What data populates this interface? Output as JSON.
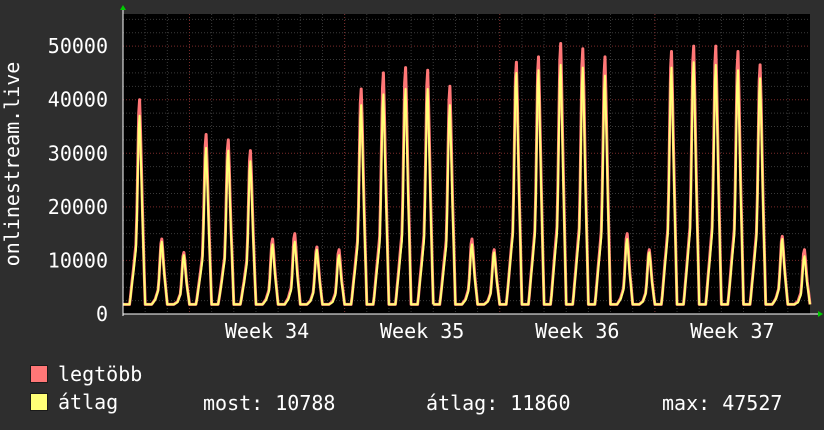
{
  "chart_data": {
    "type": "area",
    "ylabel": "onlinestream.live",
    "ylim": [
      0,
      56000
    ],
    "yticks": [
      0,
      10000,
      20000,
      30000,
      40000,
      50000
    ],
    "ytick_labels": [
      "0",
      "10000",
      "20000",
      "30000",
      "40000",
      "50000"
    ],
    "week_labels": [
      "Week 34",
      "Week 35",
      "Week 36",
      "Week 37"
    ],
    "series": [
      {
        "name": "legtöbb",
        "key": "max",
        "color": "#ff7777"
      },
      {
        "name": "átlag",
        "key": "avg",
        "color": "#ffff77"
      }
    ],
    "days": [
      {
        "max": 40000,
        "avg": 37000
      },
      {
        "max": 14000,
        "avg": 13500
      },
      {
        "max": 11500,
        "avg": 11000
      },
      {
        "max": 33500,
        "avg": 31000
      },
      {
        "max": 32500,
        "avg": 30500
      },
      {
        "max": 30500,
        "avg": 28500
      },
      {
        "max": 14000,
        "avg": 13000
      },
      {
        "max": 15000,
        "avg": 13500
      },
      {
        "max": 12500,
        "avg": 12000
      },
      {
        "max": 12000,
        "avg": 11000
      },
      {
        "max": 42000,
        "avg": 39000
      },
      {
        "max": 45000,
        "avg": 41000
      },
      {
        "max": 46000,
        "avg": 42000
      },
      {
        "max": 45500,
        "avg": 42000
      },
      {
        "max": 42500,
        "avg": 39000
      },
      {
        "max": 14000,
        "avg": 13000
      },
      {
        "max": 12000,
        "avg": 11500
      },
      {
        "max": 47000,
        "avg": 45000
      },
      {
        "max": 48000,
        "avg": 45500
      },
      {
        "max": 50500,
        "avg": 46500
      },
      {
        "max": 49500,
        "avg": 46000
      },
      {
        "max": 48000,
        "avg": 44500
      },
      {
        "max": 15000,
        "avg": 14000
      },
      {
        "max": 12000,
        "avg": 11500
      },
      {
        "max": 49000,
        "avg": 46000
      },
      {
        "max": 50000,
        "avg": 47000
      },
      {
        "max": 50000,
        "avg": 46500
      },
      {
        "max": 49000,
        "avg": 45500
      },
      {
        "max": 46500,
        "avg": 44000
      },
      {
        "max": 14500,
        "avg": 14000
      },
      {
        "max": 12000,
        "avg": 10788
      }
    ],
    "gap_after_day": 13,
    "legend": [
      {
        "label": "legtöbb",
        "color": "#ff7777"
      },
      {
        "label": "átlag",
        "color": "#ffff77"
      }
    ],
    "stats": {
      "current": "most: 10788",
      "average": "átlag: 11860",
      "maximum": "max: 47527"
    }
  }
}
